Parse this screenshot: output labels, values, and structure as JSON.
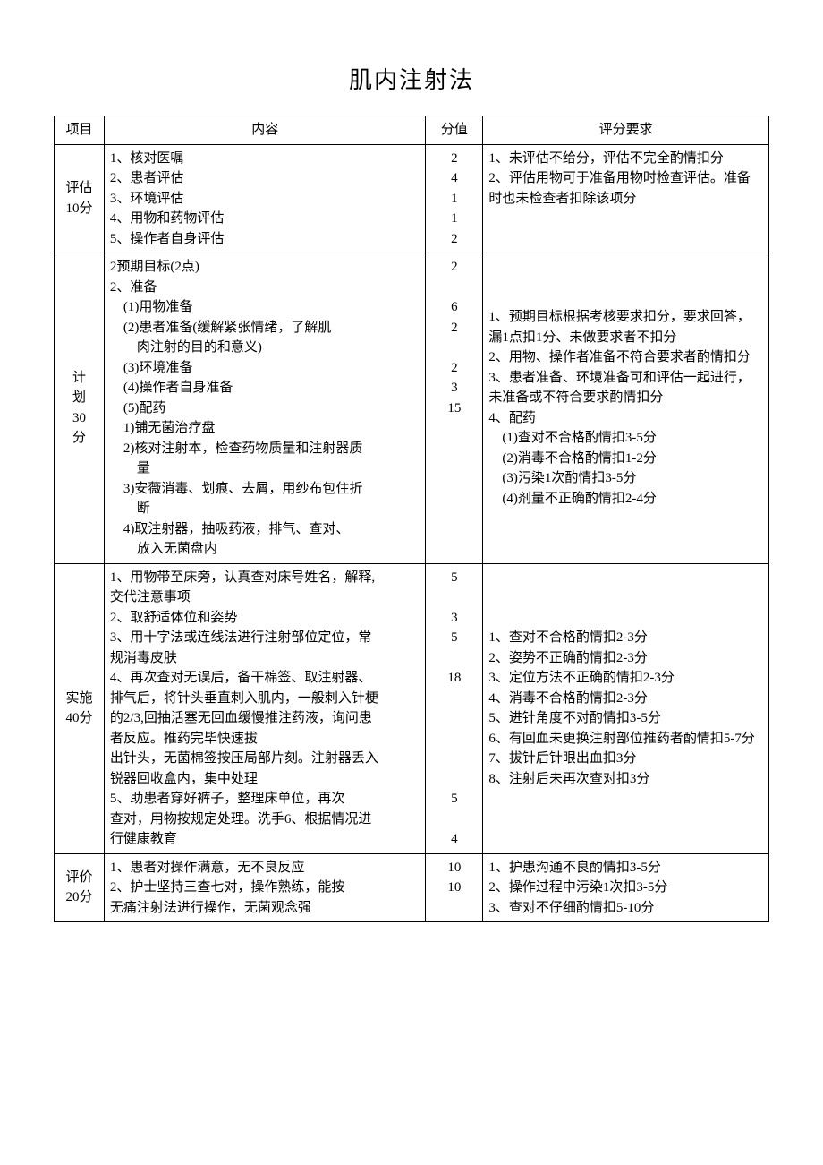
{
  "title": "肌内注射法",
  "headers": {
    "project": "项目",
    "content": "内容",
    "score": "分值",
    "requirement": "评分要求"
  },
  "rows": [
    {
      "project": "评估\n10分",
      "content_lines": [
        "1、核对医嘱",
        "2、患者评估",
        "3、环境评估",
        "4、用物和药物评估",
        "5、操作者自身评估"
      ],
      "score_lines": [
        "2",
        "4",
        "1",
        "1",
        "2"
      ],
      "req_lines": [
        "1、未评估不给分，评估不完全酌情扣分",
        "2、评估用物可于准备用物时检查评估。准备时也未检查者扣除该项分"
      ]
    },
    {
      "project": "计\n划\n30\n分",
      "content_lines": [
        "2预期目标(2点)",
        "2、准备",
        "　(1)用物准备",
        "　(2)患者准备(缓解紧张情绪，了解肌",
        "　　肉注射的目的和意义)",
        "　(3)环境准备",
        "　(4)操作者自身准备",
        "　(5)配药",
        "　1)铺无菌治疗盘",
        "　2)核对注射本，检查药物质量和注射器质",
        "　　量",
        "　3)安薇消毒、划痕、去屑，用纱布包住折",
        "　　断",
        "　4)取注射器，抽吸药液，排气、查对、",
        "　　放入无菌盘内"
      ],
      "score_lines": [
        "2",
        "",
        "6",
        "2",
        "",
        "2",
        "3",
        "15",
        "",
        "",
        "",
        "",
        "",
        "",
        ""
      ],
      "req_lines": [
        "1、预期目标根据考核要求扣分，要求回答，漏1点扣1分、未做要求者不扣分",
        "2、用物、操作者准备不符合要求者酌情扣分",
        "3、患者准备、环境准备可和评估一起进行，未准备或不符合要求酌情扣分",
        "4、配药",
        "　(1)查对不合格酌情扣3-5分",
        "　(2)消毒不合格酌情扣1-2分",
        "　(3)污染1次酌情扣3-5分",
        "　(4)剂量不正确酌情扣2-4分"
      ]
    },
    {
      "project": "实施\n40分",
      "content_lines": [
        "1、用物带至床旁，认真查对床号姓名，解释,",
        "交代注意事项",
        "2、取舒适体位和姿势",
        "3、用十字法或连线法进行注射部位定位，常",
        "规消毒皮肤",
        "4、再次查对无误后，备干棉签、取注射器、",
        "排气后，将针头垂直刺入肌内，一般刺入针梗",
        "的2/3,回抽活塞无回血缓慢推注药液，询问患",
        "者反应。推药完毕快速拔",
        "出针头，无菌棉签按压局部片刻。注射器丢入",
        "锐器回收盒内，集中处理",
        "5、助患者穿好裤子，整理床单位，再次",
        "查对，用物按规定处理。洗手6、根据情况进",
        "行健康教育"
      ],
      "score_lines": [
        "5",
        "",
        "3",
        "5",
        "",
        "18",
        "",
        "",
        "",
        "",
        "",
        "5",
        "",
        "4"
      ],
      "req_lines": [
        "1、查对不合格酌情扣2-3分",
        "2、姿势不正确酌情扣2-3分",
        "3、定位方法不正确酌情扣2-3分",
        "4、消毒不合格酌情扣2-3分",
        "5、进针角度不对酌情扣3-5分",
        "6、有回血未更换注射部位推药者酌情扣5-7分",
        "7、拔针后针眼出血扣3分",
        "8、注射后未再次查对扣3分"
      ]
    },
    {
      "project": "评价\n20分",
      "content_lines": [
        "1、患者对操作满意，无不良反应",
        "2、护士坚持三查七对，操作熟练，能按",
        "无痛注射法进行操作，无菌观念强"
      ],
      "score_lines": [
        "10",
        "10",
        ""
      ],
      "req_lines": [
        "1、护患沟通不良酌情扣3-5分",
        "2、操作过程中污染1次扣3-5分",
        "3、查对不仔细酌情扣5-10分"
      ]
    }
  ]
}
